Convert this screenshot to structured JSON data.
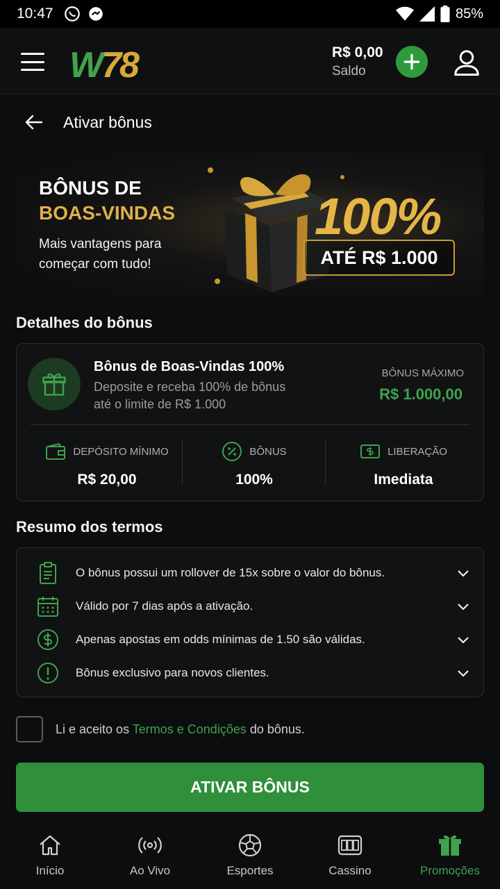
{
  "status_bar": {
    "time": "10:47",
    "battery": "85%"
  },
  "header": {
    "logo_w": "W",
    "logo_num": "78",
    "balance_amount": "R$ 0,00",
    "balance_label": "Saldo"
  },
  "page": {
    "title": "Ativar bônus"
  },
  "banner": {
    "title_line1": "BÔNUS DE",
    "title_line2": "BOAS-VINDAS",
    "subtitle": "Mais vantagens para começar com tudo!",
    "percent": "100%",
    "up_to": "ATÉ R$ 1.000"
  },
  "details": {
    "section_title": "Detalhes do bônus",
    "bonus_name": "Bônus de Boas-Vindas 100%",
    "bonus_desc": "Deposite e receba 100% de bônus até o limite de R$ 1.000",
    "max_label": "BÔNUS MÁXIMO",
    "max_value": "R$ 1.000,00",
    "stats": [
      {
        "label": "DEPÓSITO MÍNIMO",
        "value": "R$ 20,00",
        "icon": "wallet-icon"
      },
      {
        "label": "BÔNUS",
        "value": "100%",
        "icon": "percent-icon"
      },
      {
        "label": "LIBERAÇÃO",
        "value": "Imediata",
        "icon": "cash-icon"
      }
    ]
  },
  "terms": {
    "section_title": "Resumo dos termos",
    "items": [
      {
        "text": "O bônus possui um rollover de 15x sobre o valor do bônus.",
        "icon": "clipboard-icon"
      },
      {
        "text": "Válido por 7 dias após a ativação.",
        "icon": "calendar-icon"
      },
      {
        "text": "Apenas apostas em odds mínimas de 1.50 são válidas.",
        "icon": "dollar-icon"
      },
      {
        "text": "Bônus exclusivo para novos clientes.",
        "icon": "alert-icon"
      }
    ]
  },
  "accept": {
    "prefix": "Li e aceito os",
    "link": "Termos e Condições",
    "suffix": "do bônus."
  },
  "activate_label": "ATIVAR BÔNUS",
  "nav": [
    {
      "label": "Início",
      "icon": "home-icon"
    },
    {
      "label": "Ao Vivo",
      "icon": "live-icon"
    },
    {
      "label": "Esportes",
      "icon": "ball-icon"
    },
    {
      "label": "Cassino",
      "icon": "slot-icon"
    },
    {
      "label": "Promoções",
      "icon": "gift-icon",
      "active": true
    }
  ],
  "colors": {
    "accent": "#3fa34d",
    "gold": "#e0b049",
    "background": "#0c0d0e"
  }
}
